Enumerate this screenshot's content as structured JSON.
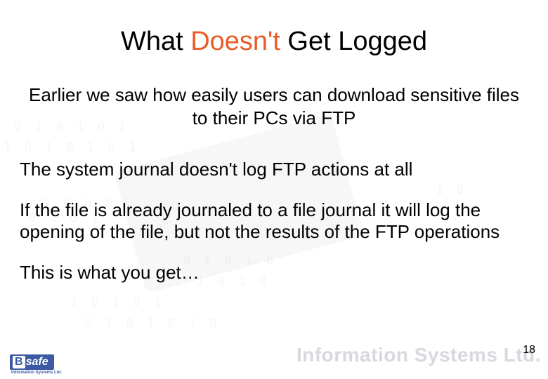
{
  "title": {
    "prefix": "What ",
    "accent": "Doesn't",
    "suffix": " Get Logged"
  },
  "intro": "Earlier we saw how easily users can download sensitive files to their PCs via FTP",
  "paragraphs": [
    "The system journal doesn't log FTP actions at all",
    "If the file is already journaled to a file journal it will log the opening of the file, but not the results of the FTP operations",
    "This is what you get…"
  ],
  "page_number": "18",
  "logo": {
    "b": "B",
    "safe": "safe",
    "sub": "Information Systems Ltd."
  },
  "watermark_text": "Information Systems Ltd.",
  "binary_lines": [
    "0 1 0 1 0 1",
    "1 0 1 0 1 0 1",
    "1 0 0 0",
    "0 1 0 1",
    "0 1 0 1 0",
    "1 0 1 0",
    "1 0 1 0 1",
    "0 1 0 1 0 1 0",
    "1 0"
  ]
}
